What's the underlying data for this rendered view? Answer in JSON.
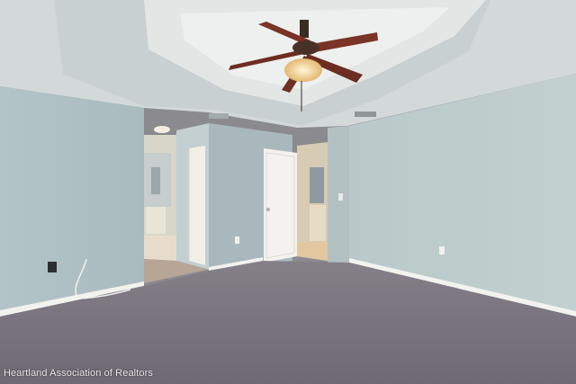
{
  "photo": {
    "subject": "empty-bedroom-with-ceiling-fan",
    "watermark": "Heartland Association of Realtors"
  },
  "colors": {
    "wall": "#b7c6c9",
    "ceiling": "#d6dcdc",
    "carpet": "#7a7480",
    "trim": "#f2f2ef",
    "fan_wood": "#7a3326",
    "fan_light": "#f4d79a"
  },
  "icons": {
    "fan": "ceiling-fan-icon",
    "outlet": "outlet-icon",
    "switch": "light-switch-icon",
    "vent": "vent-icon"
  }
}
